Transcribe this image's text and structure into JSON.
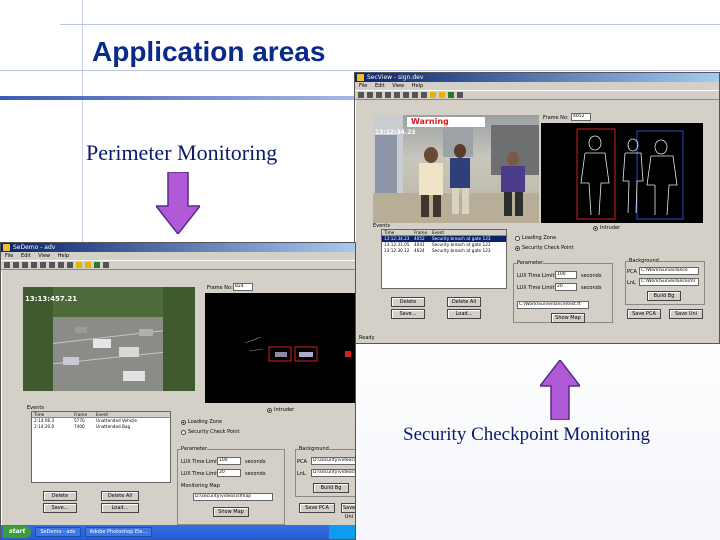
{
  "slide": {
    "title": "Application areas",
    "caption_left": "Perimeter Monitoring",
    "caption_right": "Security Checkpoint Monitoring"
  },
  "colors": {
    "title": "#0a2a8a",
    "arrow_fill": "#b05ad8",
    "window_face": "#d4d0c8",
    "titlebar": "#0a246a",
    "warning": "#d02020",
    "taskbar": "#245edb"
  },
  "win_checkpoint": {
    "title": "SecView - sign.dev",
    "menu": [
      "File",
      "Edit",
      "View",
      "Help"
    ],
    "warning_label": "Warning",
    "timestamp": "13:12:34.23",
    "frame_label": "Frame No:",
    "frame_value": "4052",
    "list_title": "Events",
    "list_headers": [
      "Time",
      "Frame",
      "Event"
    ],
    "list_rows": [
      [
        "13:12:34.23",
        "4052",
        "Security breach at gate 123"
      ],
      [
        "13:12:31.05",
        "4041",
        "Security breach at gate 123"
      ],
      [
        "13:12:30.12",
        "4024",
        "Security breach at gate 123"
      ]
    ],
    "intruder_label": "Intruder",
    "radios": [
      "Loading Zone",
      "Security Check Point"
    ],
    "params_label": "Parameter",
    "param1_label": "LUX Time Limit",
    "param1_value": "100",
    "param1_unit": "seconds",
    "param2_label": "LUX Time Limit",
    "param2_value": "20",
    "param2_unit": "seconds",
    "bg_label": "Background",
    "pca_label": "PCA",
    "pca_value": "C:\\Work\\Surveillance",
    "lnl_label": "LnL",
    "lnl_value": "C:\\Work\\Surveillance\\mI",
    "build_btn": "Build Bg",
    "delete_btn": "Delete",
    "delete_all_btn": "Delete All",
    "save_btn": "Save...",
    "load_btn": "Load...",
    "path_value": "C:\\Work\\Surveillance\\test.ft",
    "show_map_btn": "Show Map",
    "save_pca_btn": "Save PCA",
    "save_uni_btn": "Save Uni",
    "status": "Ready"
  },
  "win_perimeter": {
    "title": "SeDemo - adv",
    "menu": [
      "File",
      "Edit",
      "View",
      "Help"
    ],
    "timestamp": "13:13:457.21",
    "frame_label": "Frame No:",
    "frame_value": "824",
    "list_title": "Events",
    "list_headers": [
      "Time",
      "Frame",
      "Event"
    ],
    "list_rows": [
      [
        "2:14:06.3",
        "5770",
        "Unattended Vehicle"
      ],
      [
        "2:14:20.0",
        "7400",
        "Unattended Bag"
      ]
    ],
    "intruder_label": "Intruder",
    "radios": [
      "Loading Zone",
      "Security Check Point"
    ],
    "params_label": "Parameter",
    "param1_label": "LUX Time Limit",
    "param1_value": "100",
    "param1_unit": "seconds",
    "param2_label": "LUX Time Limit",
    "param2_value": "20",
    "param2_unit": "seconds",
    "bg_label": "Background",
    "pca_label": "PCA",
    "pca_value": "D:\\security\\videos\\ca",
    "lnl_label": "LnL",
    "lnl_value": "D:\\security\\videos\\ca",
    "build_btn": "Build Bg",
    "delete_btn": "Delete",
    "delete_all_btn": "Delete All",
    "save_btn": "Save...",
    "load_btn": "Load...",
    "monitoring_label": "Monitoring Map",
    "path_value": "D:\\security\\videos\\sfmap",
    "show_map_btn": "Show Map",
    "save_pca_btn": "Save PCA",
    "save_uni_btn": "Save Uni"
  },
  "taskbar": {
    "start": "start",
    "tasks": [
      "SeDemo - adv",
      "Adobe Photoshop Ele..."
    ]
  }
}
